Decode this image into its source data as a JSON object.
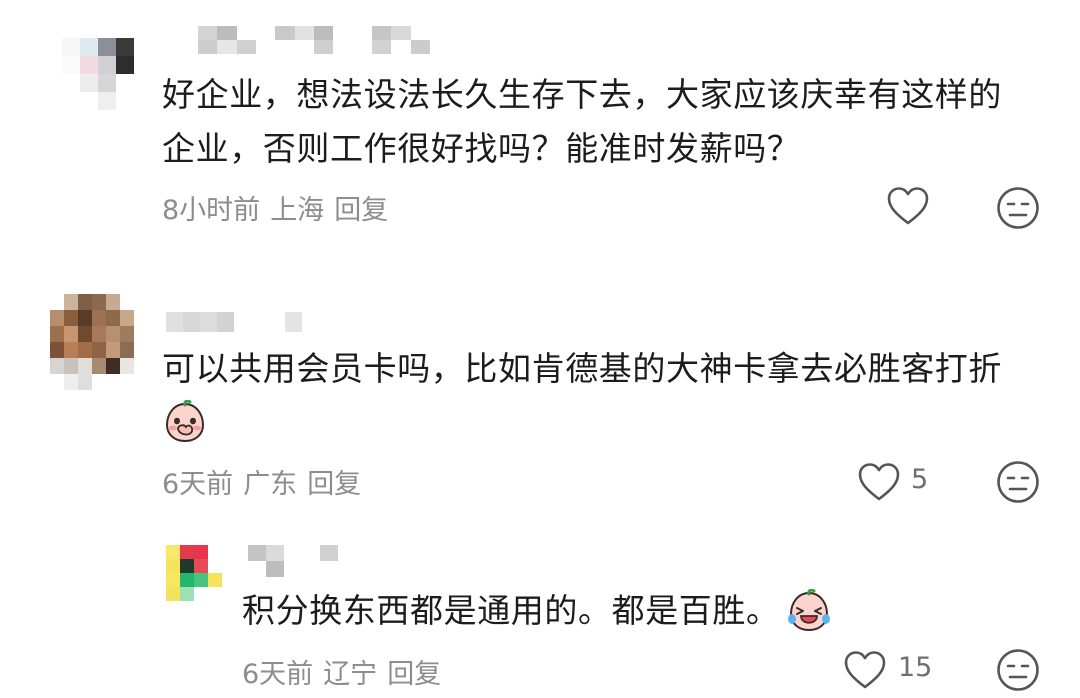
{
  "comments": [
    {
      "line1": "好企业，想法设法长久生存下去，大家应该庆幸有这样的",
      "line2": "企业，否则工作很好找吗？能准时发薪吗？",
      "time": "8小时前",
      "location": "上海",
      "reply_label": "回复",
      "like_icon": "heart-outline-icon",
      "dislike_icon": "neutral-face-icon"
    },
    {
      "line1": "可以共用会员卡吗，比如肯德基的大神卡拿去必胜客打折",
      "emoji": "covering-mouth-peach-emoji",
      "time": "6天前",
      "location": "广东",
      "reply_label": "回复",
      "like_count": "5",
      "like_icon": "heart-outline-icon",
      "dislike_icon": "neutral-face-icon"
    },
    {
      "line1": "积分换东西都是通用的。都是百胜。",
      "emoji": "laugh-crying-peach-emoji",
      "time": "6天前",
      "location": "辽宁",
      "reply_label": "回复",
      "like_count": "15",
      "like_icon": "heart-outline-icon",
      "dislike_icon": "neutral-face-icon"
    }
  ]
}
